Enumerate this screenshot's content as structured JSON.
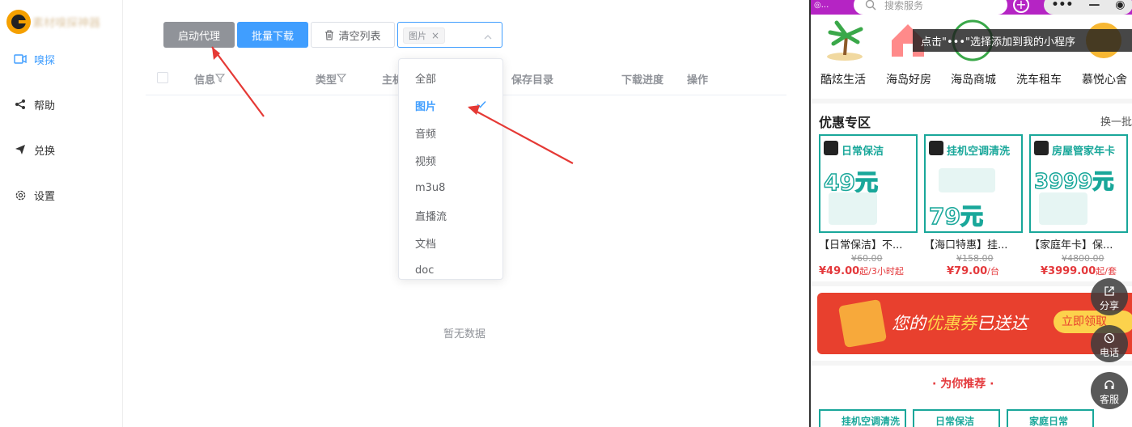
{
  "sidebar": {
    "app_name": "素材嗅探神器",
    "items": [
      {
        "label": "嗅探",
        "icon": "video-camera-icon",
        "active": true
      },
      {
        "label": "帮助",
        "icon": "share-icon"
      },
      {
        "label": "兑换",
        "icon": "send-icon"
      },
      {
        "label": "设置",
        "icon": "gear-icon"
      }
    ]
  },
  "toolbar": {
    "start_proxy_label": "启动代理",
    "batch_download_label": "批量下载",
    "clear_list_label": "清空列表",
    "filter": {
      "selected_tag": "图片"
    }
  },
  "table": {
    "columns": [
      "信息",
      "类型",
      "主机",
      "保存目录",
      "下载进度",
      "操作"
    ],
    "empty_text": "暂无数据"
  },
  "dropdown": {
    "options": [
      "全部",
      "图片",
      "音频",
      "视频",
      "m3u8",
      "直播流",
      "文档",
      "doc"
    ],
    "selected": "图片"
  },
  "right_panel": {
    "location": "◎...",
    "search_placeholder": "搜索服务",
    "capsule": {
      "more": "•••",
      "minus": "—",
      "close": "◉"
    },
    "tip": "点击\"•••\"选择添加到我的小程序",
    "categories": [
      "酷炫生活",
      "海岛好房",
      "海岛商城",
      "洗车租车",
      "慕悦心舍"
    ],
    "section_title": "优惠专区",
    "section_more": "换一批",
    "products": [
      {
        "header": "日常保洁",
        "big": "49元",
        "title": "【日常保洁】不...",
        "old_price": "¥60.00",
        "price": "¥49.00",
        "unit": "起/3小时起"
      },
      {
        "header": "挂机空调清洗",
        "big": "79元",
        "title": "【海口特惠】挂...",
        "old_price": "¥158.00",
        "price": "¥79.00",
        "unit": "/台"
      },
      {
        "header": "房屋管家年卡",
        "big": "3999元",
        "title": "【家庭年卡】保...",
        "old_price": "¥4800.00",
        "price": "¥3999.00",
        "unit": "起/套"
      }
    ],
    "banner": {
      "prefix": "您的",
      "highlight": "优惠券",
      "suffix": "已送达",
      "button": "立即领取"
    },
    "recommend_title": "·  为你推荐  ·",
    "mini_cards": [
      "挂机空调清洗",
      "日常保洁",
      "家庭日常"
    ],
    "float_buttons": [
      "分享",
      "电话",
      "客服"
    ]
  }
}
